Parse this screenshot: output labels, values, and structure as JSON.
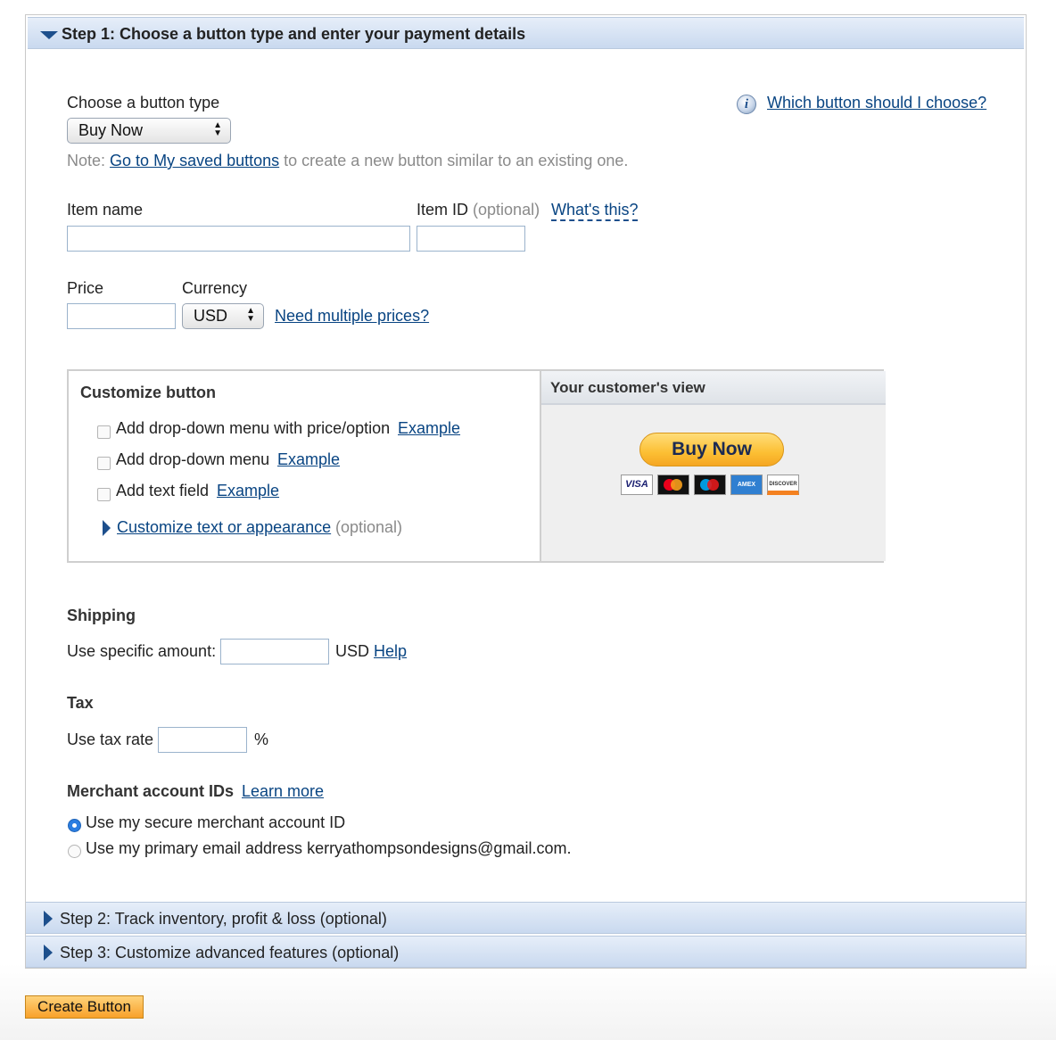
{
  "step1": {
    "title": "Step 1: Choose a button type and enter your payment details"
  },
  "button_type": {
    "label": "Choose a button type",
    "selected": "Buy Now",
    "help_link": "Which button should I choose?",
    "note_prefix": "Note:",
    "note_link": "Go to My saved buttons",
    "note_suffix": "to create a new button similar to an existing one."
  },
  "item": {
    "name_label": "Item name",
    "name_value": "",
    "id_label": "Item ID",
    "id_optional": "(optional)",
    "id_value": "",
    "whats_this": "What's this?"
  },
  "price": {
    "label": "Price",
    "value": "",
    "currency_label": "Currency",
    "currency_selected": "USD",
    "multiple_prices_link": "Need multiple prices?"
  },
  "customize": {
    "title": "Customize button",
    "options": [
      {
        "label": "Add drop-down menu with price/option",
        "link": "Example",
        "checked": false
      },
      {
        "label": "Add drop-down menu",
        "link": "Example",
        "checked": false
      },
      {
        "label": "Add text field",
        "link": "Example",
        "checked": false
      }
    ],
    "appearance_link": "Customize text or appearance",
    "appearance_optional": "(optional)"
  },
  "preview": {
    "title": "Your customer's view",
    "button_label": "Buy Now",
    "cards": [
      "VISA",
      "mastercard",
      "maestro",
      "AMEX",
      "DISCOVER"
    ]
  },
  "shipping": {
    "title": "Shipping",
    "label": "Use specific amount:",
    "value": "",
    "currency": "USD",
    "help_link": "Help"
  },
  "tax": {
    "title": "Tax",
    "label": "Use tax rate",
    "value": "",
    "unit": "%"
  },
  "merchant": {
    "title": "Merchant account IDs",
    "learn_more": "Learn more",
    "options": [
      {
        "label": "Use my secure merchant account ID",
        "selected": true
      },
      {
        "label": "Use my primary email address kerryathompsondesigns@gmail.com.",
        "selected": false
      }
    ]
  },
  "step2": {
    "title": "Step 2: Track inventory, profit & loss (optional)"
  },
  "step3": {
    "title": "Step 3: Customize advanced features (optional)"
  },
  "create_button": "Create Button",
  "colors": {
    "link": "#084482",
    "header_gradient_top": "#e6eef9",
    "header_gradient_bottom": "#c9d9ef",
    "button_orange": "#f8a12a"
  }
}
